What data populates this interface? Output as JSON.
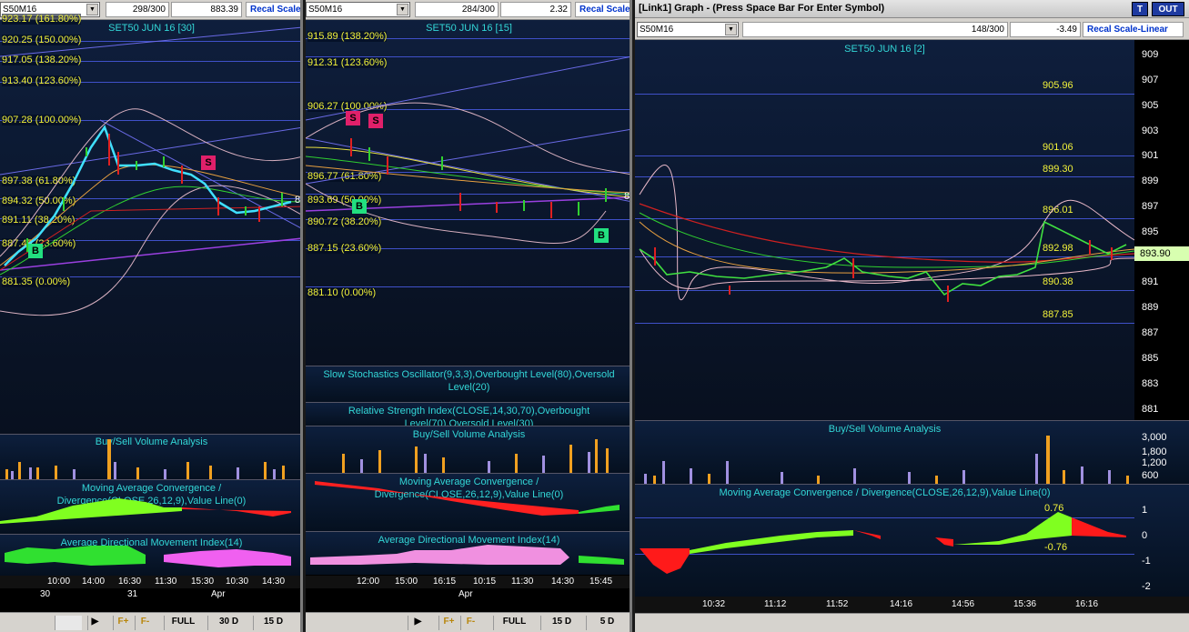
{
  "p1": {
    "symbol": "S50M16",
    "bars": "298/300",
    "last": "883.39",
    "recal": "Recal Scale",
    "title": "SET50 JUN 16  [30]",
    "fib_top": "923.17 (161.80%)",
    "fibs": [
      "920.25 (150.00%)",
      "917.05 (138.20%)",
      "913.40 (123.60%)",
      "907.28 (100.00%)",
      "897.38 (61.80%)",
      "894.32 (50.00%)",
      "891.11 (38.20%)",
      "887.45 (23.60%)",
      "881.35 (0.00%)"
    ],
    "right_tag": "8",
    "sell": "S",
    "buy": "B",
    "sub_vol": "Buy/Sell Volume Analysis",
    "sub_macd": "Moving Average Convergence / Divergence(CLOSE,26,12,9),Value Line(0)",
    "sub_adx": "Average Directional Movement Index(14)",
    "times": [
      "10:00",
      "14:00",
      "16:30",
      "11:30",
      "15:30",
      "10:30",
      "14:30"
    ],
    "dates": [
      "30",
      "31",
      "Apr"
    ],
    "btns": [
      "F+",
      "F-",
      "FULL",
      "30 D",
      "15 D"
    ]
  },
  "p2": {
    "symbol": "S50M16",
    "bars": "284/300",
    "last": "2.32",
    "recal": "Recal Scale",
    "title": "SET50 JUN 16  [15]",
    "fibs": [
      "915.89 (138.20%)",
      "912.31 (123.60%)",
      "906.27 (100.00%)",
      "896.77 (61.80%)",
      "893.69 (50.00%)",
      "890.72 (38.20%)",
      "887.15 (23.60%)",
      "881.10 (0.00%)"
    ],
    "right_tag": "8",
    "sell": "S",
    "buy": "B",
    "sub_stoch": "Slow Stochastics Oscillator(9,3,3),Overbought Level(80),Oversold Level(20)",
    "sub_rsi": "Relative Strength Index(CLOSE,14,30,70),Overbought Level(70),Oversold Level(30)",
    "sub_vol": "Buy/Sell Volume Analysis",
    "sub_macd": "Moving Average Convergence / Divergence(CLOSE,26,12,9),Value Line(0)",
    "sub_adx": "Average Directional Movement Index(14)",
    "times": [
      "12:00",
      "15:00",
      "16:15",
      "10:15",
      "11:30",
      "14:30",
      "15:45"
    ],
    "dates": [
      "Apr"
    ],
    "btns": [
      "F+",
      "F-",
      "FULL",
      "15 D",
      "5 D"
    ]
  },
  "p3": {
    "window_title": "[Link1] Graph  - (Press Space Bar For Enter Symbol)",
    "t_btn": "T",
    "out_btn": "OUT",
    "symbol": "S50M16",
    "bars": "148/300",
    "last": "-3.49",
    "recal": "Recal Scale-Linear",
    "title": "SET50 JUN 16  [2]",
    "levels": [
      "905.96",
      "901.06",
      "899.30",
      "896.01",
      "892.98",
      "890.38",
      "887.85"
    ],
    "price_tag": "893.90",
    "yaxis": [
      "909",
      "907",
      "905",
      "903",
      "901",
      "899",
      "897",
      "895",
      "893",
      "891",
      "889",
      "887",
      "885",
      "883",
      "881"
    ],
    "sub_vol": "Buy/Sell Volume Analysis",
    "vol_axis": [
      "3,000",
      "1,800",
      "1,200",
      "600"
    ],
    "sub_macd": "Moving Average Convergence / Divergence(CLOSE,26,12,9),Value Line(0)",
    "macd_hi": "0.76",
    "macd_lo": "-0.76",
    "macd_axis": [
      "1",
      "0",
      "-1",
      "-2"
    ],
    "times": [
      "10:32",
      "11:12",
      "11:52",
      "14:16",
      "14:56",
      "15:36",
      "16:16"
    ]
  },
  "colors": {
    "fib": "#f2f23a",
    "title": "#33d7d7",
    "level_line": "#3f50c8",
    "buy_marker": "#22e080",
    "sell_marker": "#e0206a"
  }
}
